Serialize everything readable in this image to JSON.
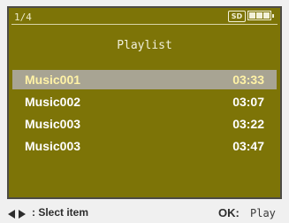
{
  "status": {
    "page_indicator": "1/4",
    "sd_label": "SD",
    "battery_level": 1.0,
    "battery_icon": "battery-full-icon"
  },
  "playlist": {
    "title": "Playlist",
    "items": [
      {
        "name": "Music001",
        "duration": "03:33",
        "selected": true
      },
      {
        "name": "Music002",
        "duration": "03:07",
        "selected": false
      },
      {
        "name": "Music003",
        "duration": "03:22",
        "selected": false
      },
      {
        "name": "Music003",
        "duration": "03:47",
        "selected": false
      }
    ]
  },
  "hints": {
    "select_label": ": Slect item",
    "ok_label": "OK:",
    "play_label": "Play"
  },
  "colors": {
    "screen_bg": "#7d7407",
    "selected_bg": "#a8a493",
    "selected_text": "#fff2a6",
    "text": "#ffffff"
  }
}
